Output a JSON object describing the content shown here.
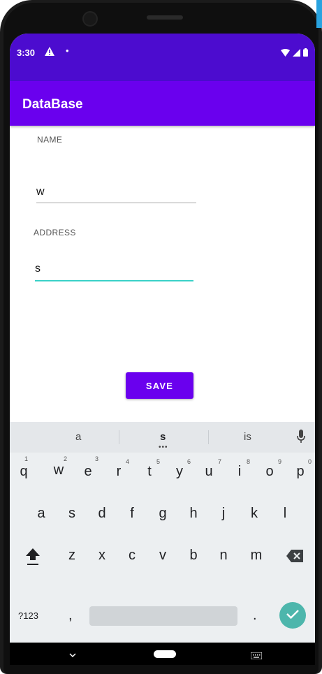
{
  "status_bar": {
    "time": "3:30"
  },
  "app_bar": {
    "title": "DataBase"
  },
  "form": {
    "name_label": "NAME",
    "name_value": "w",
    "address_label": "ADDRESS",
    "address_value": "s",
    "save_label": "SAVE"
  },
  "keyboard": {
    "suggestions": [
      "a",
      "s",
      "is"
    ],
    "row1": [
      "q",
      "w",
      "e",
      "r",
      "t",
      "y",
      "u",
      "i",
      "o",
      "p"
    ],
    "row1_hints": [
      "1",
      "2",
      "3",
      "4",
      "5",
      "6",
      "7",
      "8",
      "9",
      "0"
    ],
    "row2": [
      "a",
      "s",
      "d",
      "f",
      "g",
      "h",
      "j",
      "k",
      "l"
    ],
    "row3": [
      "z",
      "x",
      "c",
      "v",
      "b",
      "n",
      "m"
    ],
    "symbols_key": "?123",
    "comma_key": ",",
    "period_key": "."
  },
  "colors": {
    "status_bar": "#4c0ccf",
    "app_bar": "#6a00ee",
    "accent_underline": "#3ad1c8",
    "enter_key": "#4db6ac"
  },
  "icons": [
    "warning-icon",
    "wifi-icon",
    "signal-icon",
    "battery-icon",
    "mic-icon",
    "shift-icon",
    "backspace-icon",
    "check-icon",
    "nav-back-icon",
    "nav-home-pill",
    "keyboard-icon"
  ]
}
